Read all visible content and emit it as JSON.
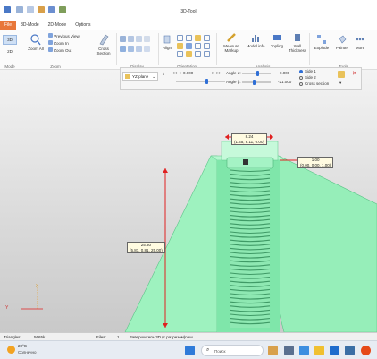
{
  "app": {
    "title": "3D-Tool"
  },
  "menu": {
    "tabs": [
      "File",
      "3D-Mode",
      "2D-Mode",
      "Options"
    ]
  },
  "ribbon": {
    "groups": {
      "mode": "Mode",
      "zoom": "Zoom",
      "display": "Display",
      "orientation": "Orientation",
      "analysis": "Analysis",
      "tools": "Tools"
    },
    "mode": {
      "btn3d": "3D",
      "btn2d": "2D"
    },
    "zoom": {
      "zoom_all": "Zoom All",
      "previous_view": "Previous View",
      "zoom_in": "Zoom In",
      "zoom_out": "Zoom Out"
    },
    "cross_section": "Cross Section",
    "align": "Align",
    "measure_markup": "Measure Markup",
    "model_info": "Model info",
    "topling": "Topling",
    "wall_thickness": "Wall Thickness",
    "explode": "Explode",
    "painter": "Painter",
    "more": "More"
  },
  "section_bar": {
    "plane": "YZ-plane",
    "value": "0.000",
    "angle_a_label": "Angle α:",
    "angle_a_value": "0.000",
    "angle_b_label": "Angle β:",
    "angle_b_value": "-21.000",
    "side1": "Side 1",
    "side2": "Side 2",
    "cross_section": "Cross section"
  },
  "measurements": {
    "top": {
      "value": "8.24",
      "coords": "(1.45, 8.11, 0.00)"
    },
    "right": {
      "value": "1.00",
      "coords": "(0.00, 0.00, 1.00)"
    },
    "left": {
      "value": "25.30",
      "coords": "(5.81, 0.81, 25.00)"
    }
  },
  "axes": {
    "y_label": "Y",
    "x_label": "X"
  },
  "status": {
    "triangles_label": "Triangles:",
    "triangles_value": "5665k",
    "files_label": "Files:",
    "files_value": "1",
    "file_text": "Завершитель 3D (с разрезом)new"
  },
  "taskbar": {
    "weather_temp": "20°C",
    "weather_desc": "Солнечно",
    "search_placeholder": "Поиск"
  },
  "colors": {
    "model_green": "#8ef0b4",
    "accent_orange": "#e8773a",
    "dimension_red": "#e02020"
  }
}
